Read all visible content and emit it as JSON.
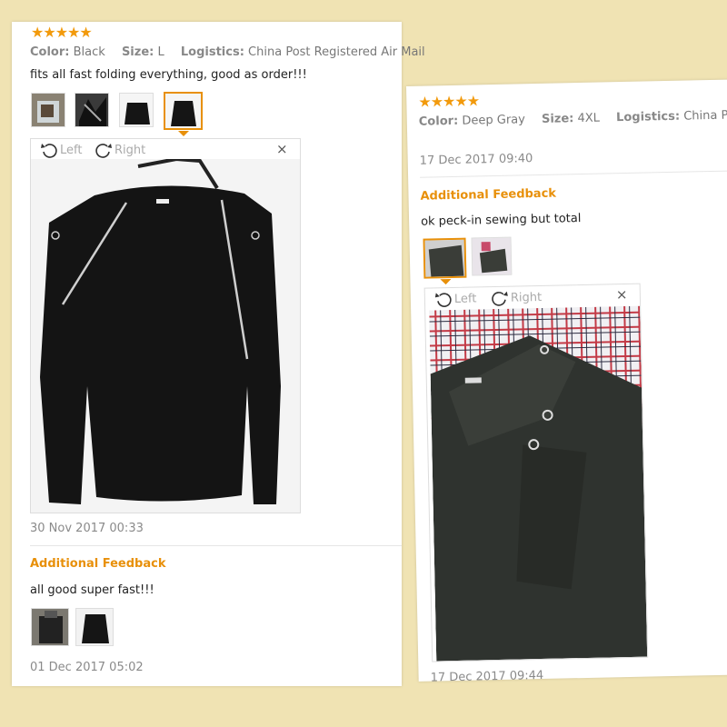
{
  "left_review": {
    "stars": "★★★★★",
    "color_label": "Color:",
    "color_value": "Black",
    "size_label": "Size:",
    "size_value": "L",
    "logistics_label": "Logistics:",
    "logistics_value": "China Post Registered Air Mail",
    "comment": "fits all fast folding everything, good as order!!!",
    "viewer": {
      "rotate_left": "Left",
      "rotate_right": "Right",
      "close": "×"
    },
    "date": "30 Nov 2017 00:33",
    "additional_title": "Additional Feedback",
    "additional_comment": "all good super fast!!!",
    "additional_date": "01 Dec 2017 05:02"
  },
  "right_review": {
    "stars": "★★★★★",
    "color_label": "Color:",
    "color_value": "Deep Gray",
    "size_label": "Size:",
    "size_value": "4XL",
    "logistics_label": "Logistics:",
    "logistics_value": "China Post",
    "date": "17 Dec 2017 09:40",
    "additional_title": "Additional Feedback",
    "additional_comment": "ok peck-in sewing but total",
    "viewer": {
      "rotate_left": "Left",
      "rotate_right": "Right",
      "close": "×"
    },
    "additional_date": "17 Dec 2017 09:44"
  },
  "colors": {
    "accent": "#e8900a",
    "star": "#f29a0c",
    "background": "#f0e3b3"
  }
}
